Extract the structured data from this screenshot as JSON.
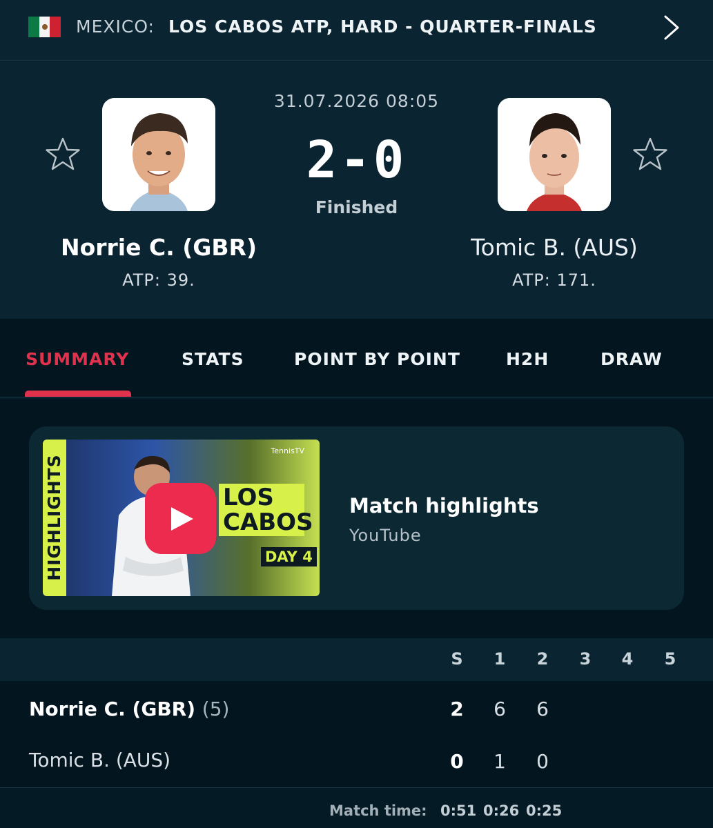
{
  "topbar": {
    "country": "MEXICO:",
    "tournament": "LOS CABOS ATP, HARD - QUARTER-FINALS"
  },
  "match": {
    "datetime": "31.07.2026 08:05",
    "score": "2-0",
    "status": "Finished"
  },
  "players": [
    {
      "name": "Norrie C. (GBR)",
      "rank": "ATP: 39."
    },
    {
      "name": "Tomic B. (AUS)",
      "rank": "ATP: 171."
    }
  ],
  "tabs": [
    {
      "label": "SUMMARY",
      "active": true
    },
    {
      "label": "STATS"
    },
    {
      "label": "POINT BY POINT"
    },
    {
      "label": "H2H"
    },
    {
      "label": "DRAW"
    }
  ],
  "highlights": {
    "title": "Match highlights",
    "source": "YouTube",
    "thumbnail": {
      "strip_text": "HIGHLIGHTS",
      "brand": "TennisTV",
      "title": "LOS CABOS",
      "day": "DAY 4"
    }
  },
  "scoreboard": {
    "columns": [
      "S",
      "1",
      "2",
      "3",
      "4",
      "5"
    ],
    "rows": [
      {
        "name": "Norrie C. (GBR)",
        "seed": "(5)",
        "sets": "2",
        "games": [
          "6",
          "6"
        ]
      },
      {
        "name": "Tomic B. (AUS)",
        "seed": "",
        "sets": "0",
        "games": [
          "1",
          "0"
        ]
      }
    ],
    "match_time_label": "Match time:",
    "match_time": [
      "0:51",
      "0:26",
      "0:25"
    ]
  },
  "colors": {
    "background": "#041a25",
    "accent": "#e0324c",
    "play_button": "#ec2b4f",
    "thumb_accent": "#d8f04a"
  }
}
